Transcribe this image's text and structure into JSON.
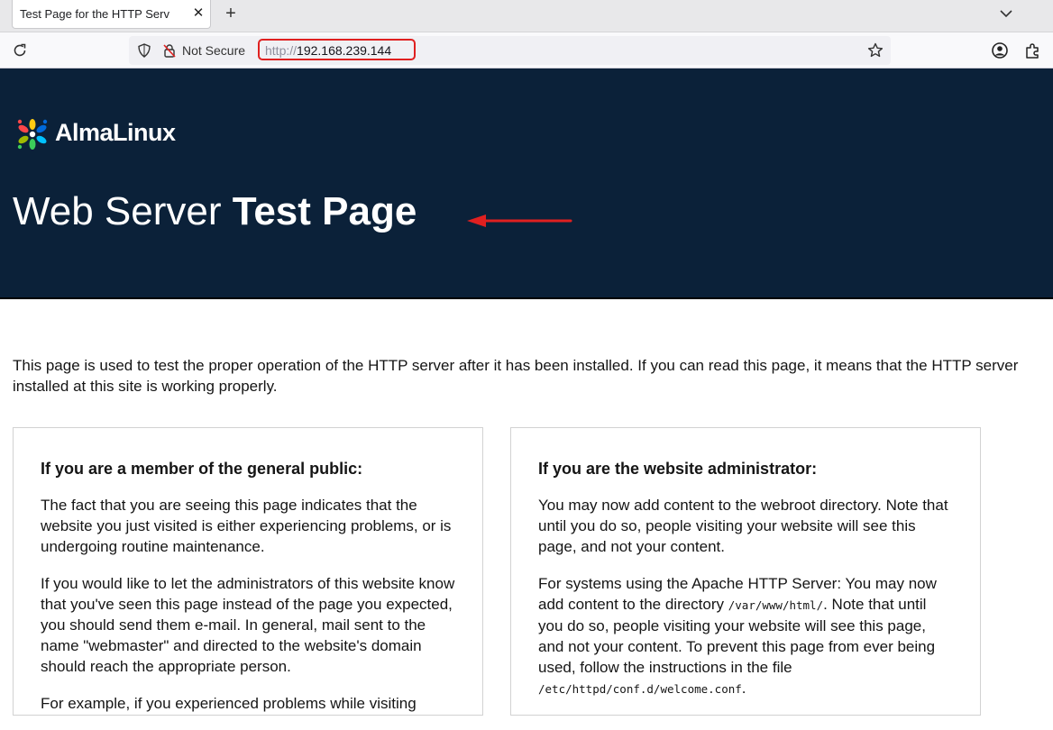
{
  "browser": {
    "tab_title": "Test Page for the HTTP Serv",
    "tab_close": "✕",
    "new_tab": "+",
    "not_secure": "Not Secure",
    "url_scheme": "http://",
    "url_host": "192.168.239.144"
  },
  "icons": {
    "reload": "reload-icon",
    "shield": "shield-icon",
    "insecure_lock": "insecure-lock-icon",
    "bookmark_star": "star-icon",
    "account": "account-icon",
    "extensions": "puzzle-icon",
    "tab_list": "chevron-down-icon"
  },
  "colors": {
    "hero_background": "#0b2139",
    "annotation_red": "#e02020"
  },
  "header": {
    "logo_text": "AlmaLinux",
    "title_light": "Web Server ",
    "title_bold": "Test Page"
  },
  "intro": "This page is used to test the proper operation of the HTTP server after it has been installed. If you can read this page, it means that the HTTP server installed at this site is working properly.",
  "cards": {
    "public": {
      "heading": "If you are a member of the general public:",
      "p1": "The fact that you are seeing this page indicates that the website you just visited is either experiencing problems, or is undergoing routine maintenance.",
      "p2": "If you would like to let the administrators of this website know that you've seen this page instead of the page you expected, you should send them e-mail. In general, mail sent to the name \"webmaster\" and directed to the website's domain should reach the appropriate person.",
      "p3": "For example, if you experienced problems while visiting"
    },
    "admin": {
      "heading": "If you are the website administrator:",
      "p1": "You may now add content to the webroot directory. Note that until you do so, people visiting your website will see this page, and not your content.",
      "p2_a": "For systems using the Apache HTTP Server: You may now add content to the directory ",
      "p2_code1": "/var/www/html/",
      "p2_b": ". Note that until you do so, people visiting your website will see this page, and not your content. To prevent this page from ever being used, follow the instructions in the file ",
      "p2_code2": "/etc/httpd/conf.d/welcome.conf",
      "p2_c": "."
    }
  }
}
